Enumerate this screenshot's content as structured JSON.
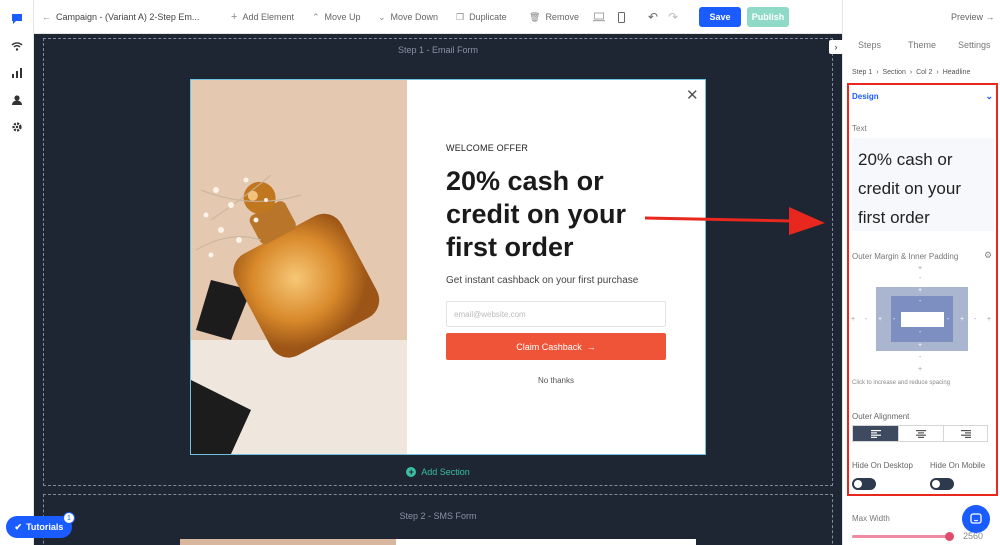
{
  "toolbar": {
    "back_label": "Campaign - (Variant A) 2-Step Em...",
    "add_element": "Add Element",
    "move_up": "Move Up",
    "move_down": "Move Down",
    "duplicate": "Duplicate",
    "remove": "Remove",
    "save": "Save",
    "publish": "Publish",
    "preview": "Preview"
  },
  "canvas": {
    "step1_label": "Step 1 - Email Form",
    "step2_label": "Step 2 - SMS Form",
    "add_section": "Add Section"
  },
  "popup": {
    "eyebrow": "WELCOME OFFER",
    "headline_l1": "20% cash or",
    "headline_l2": "credit on your",
    "headline_l3": "first order",
    "subtext": "Get instant cashback on your first purchase",
    "email_placeholder": "email@website.com",
    "cta": "Claim Cashback",
    "no_thanks": "No thanks"
  },
  "sidebar": {
    "tabs": [
      "Steps",
      "Theme",
      "Settings"
    ],
    "breadcrumb": [
      "Step 1",
      "Section",
      "Col 2",
      "Headline"
    ],
    "design": "Design",
    "text_label": "Text",
    "text_l1": "20% cash or",
    "text_l2": "credit on your",
    "text_l3": "first order",
    "margin_label": "Outer Margin & Inner Padding",
    "spacing_hint": "Click to increase and reduce spacing",
    "alignment_label": "Outer Alignment",
    "hide_desktop": "Hide On Desktop",
    "hide_mobile": "Hide On Mobile",
    "max_width": "Max Width",
    "max_width_value": "2560"
  },
  "tutorials": {
    "label": "Tutorials",
    "badge": "1"
  },
  "colors": {
    "save": "#1a5cff",
    "publish": "#8fd9c7",
    "cta": "#f05438",
    "canvas": "#1e2533",
    "highlight": "#e8281e",
    "link": "#1a5cff"
  }
}
